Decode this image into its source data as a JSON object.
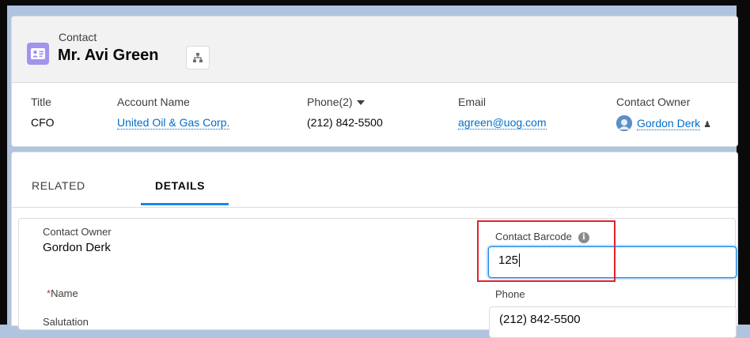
{
  "header": {
    "record_type": "Contact",
    "record_name": "Mr. Avi Green",
    "highlights": [
      {
        "label": "Title",
        "value": "CFO"
      },
      {
        "label": "Account Name",
        "value": "United Oil & Gas Corp."
      },
      {
        "label": "Phone(2)",
        "value": "(212) 842-5500"
      },
      {
        "label": "Email",
        "value": "agreen@uog.com"
      },
      {
        "label": "Contact Owner",
        "value": "Gordon Derk"
      }
    ]
  },
  "tabs": [
    {
      "label": "RELATED"
    },
    {
      "label": "DETAILS",
      "active": true
    }
  ],
  "details": {
    "contact_owner_label": "Contact Owner",
    "contact_owner_value": "Gordon Derk",
    "barcode_label": "Contact Barcode",
    "barcode_value": "125",
    "name_label": "Name",
    "required_marker": "*",
    "phone_label": "Phone",
    "salutation_label": "Salutation",
    "phone_value": "(212) 842-5500"
  },
  "colors": {
    "contact_icon": "#a094ed",
    "link": "#006dcc",
    "tab_active_underline": "#1589ee",
    "highlight_box": "#e0232e",
    "required": "#c23934"
  },
  "icons": {
    "contact": "contact-card-icon",
    "hierarchy": "hierarchy-icon",
    "phone_dropdown": "caret-down-icon",
    "owner_avatar": "user-avatar-icon",
    "change_owner": "change-owner-icon",
    "field_help": "info-icon"
  }
}
